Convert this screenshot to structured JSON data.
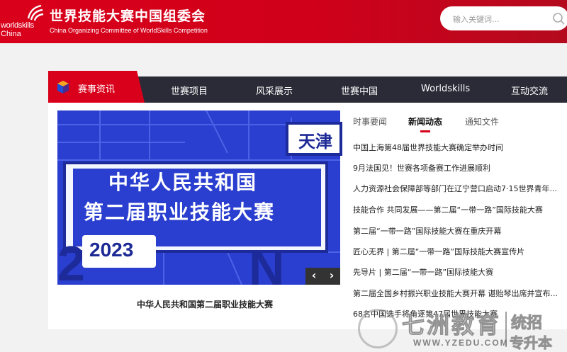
{
  "header": {
    "logo_text_1": "worldskills",
    "logo_text_2": "China",
    "title_cn": "世界技能大赛中国组委会",
    "title_en": "China Organizing Committee of WorldSkills Competition",
    "search_placeholder": "输入关键词..."
  },
  "nav": {
    "active": "赛事资讯",
    "items": [
      "世赛项目",
      "风采展示",
      "世赛中国",
      "Worldskills",
      "互动交流"
    ]
  },
  "banner": {
    "badge": "天津",
    "line1": "中华人民共和国",
    "line2": "第二届职业技能大赛",
    "year": "2023",
    "prev": "‹",
    "next": "›",
    "caption": "中华人民共和国第二届职业技能大赛"
  },
  "tabs": [
    "时事要闻",
    "新闻动态",
    "通知文件"
  ],
  "active_tab": "新闻动态",
  "news": [
    "中国上海第48届世界技能大赛确定举办时间",
    "9月法国见！世赛各项备赛工作进展顺利",
    "人力资源社会保障部等部门在辽宁营口启动7·15世界青年...",
    "技能合作 共同发展——第二届“一带一路”国际技能大赛",
    "第二届“一带一路”国际技能大赛在重庆开幕",
    "匠心无界 | 第二届“一带一路”国际技能大赛宣传片",
    "先导片 | 第二届“一带一路”国际技能大赛",
    "第二届全国乡村振兴职业技能大赛开幕 谌贻琴出席并宣布...",
    "68名中国选手将角逐第47届世界技能大赛"
  ],
  "watermark": {
    "brand": "七洲教育",
    "url": "WWW.YZEDU.COM",
    "right1": "统招",
    "right2": "专升本"
  },
  "colors": {
    "brand_red": "#d9001b",
    "nav_dark": "#2b2b38",
    "banner_blue": "#2a3fcf"
  }
}
